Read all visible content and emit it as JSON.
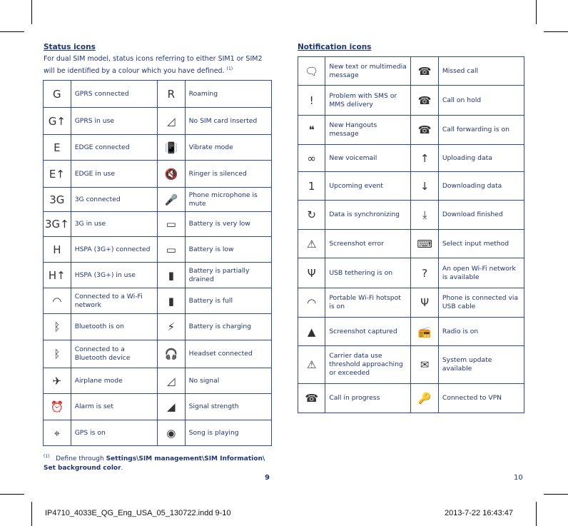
{
  "left": {
    "title": "Status icons",
    "intro": "For dual SIM model, status icons referring to either SIM1 or SIM2 will be identified by a colour which you have defined.",
    "intro_note": "(1)",
    "rows": [
      [
        "G",
        "GPRS connected",
        "R",
        "Roaming"
      ],
      [
        "G↑",
        "GPRS in use",
        "◿",
        "No SIM card inserted"
      ],
      [
        "E",
        "EDGE connected",
        "📳",
        "Vibrate mode"
      ],
      [
        "E↑",
        "EDGE in use",
        "🔇",
        "Ringer is silenced"
      ],
      [
        "3G",
        "3G connected",
        "🎤",
        "Phone microphone is mute"
      ],
      [
        "3G↑",
        "3G in use",
        "▭",
        "Battery is very low"
      ],
      [
        "H",
        "HSPA (3G+) connected",
        "▭",
        "Battery is low"
      ],
      [
        "H↑",
        "HSPA (3G+) in use",
        "▮",
        "Battery is partially drained"
      ],
      [
        "◠",
        "Connected to a Wi-Fi network",
        "▮",
        "Battery is full"
      ],
      [
        "ᛒ",
        "Bluetooth is on",
        "⚡",
        "Battery is charging"
      ],
      [
        "ᛒ",
        "Connected to a Bluetooth device",
        "🎧",
        "Headset connected"
      ],
      [
        "✈",
        "Airplane mode",
        "◿",
        "No signal"
      ],
      [
        "⏰",
        "Alarm is set",
        "◢",
        "Signal strength"
      ],
      [
        "⌖",
        "GPS is on",
        "◉",
        "Song is playing"
      ]
    ],
    "footnote_mark": "(1)",
    "footnote_text": "Define through ",
    "footnote_bold": "Settings\\SIM management\\SIM Information\\ Set background color",
    "footnote_end": ".",
    "page": "9"
  },
  "right": {
    "title": "Notification icons",
    "rows": [
      [
        "🗨",
        "New text or multimedia message",
        "☎",
        "Missed call"
      ],
      [
        "!",
        "Problem with SMS or MMS delivery",
        "☎",
        "Call on hold"
      ],
      [
        "❝",
        "New Hangouts message",
        "☎",
        "Call forwarding is on"
      ],
      [
        "∞",
        "New voicemail",
        "↑",
        "Uploading data"
      ],
      [
        "1",
        "Upcoming event",
        "↓",
        "Downloading data"
      ],
      [
        "↻",
        "Data is synchronizing",
        "⤓",
        "Download finished"
      ],
      [
        "⚠",
        "Screenshot error",
        "⌨",
        "Select input method"
      ],
      [
        "Ψ",
        "USB tethering is on",
        "?",
        "An open Wi-Fi network is available"
      ],
      [
        "◠",
        "Portable Wi-Fi hotspot is on",
        "Ψ",
        "Phone is connected via USB cable"
      ],
      [
        "▲",
        "Screenshot captured",
        "📻",
        "Radio is on"
      ],
      [
        "⚠",
        "Carrier data use threshold approaching or exceeded",
        "✉",
        "System update available"
      ],
      [
        "☎",
        "Call in progress",
        "🔑",
        "Connected to VPN"
      ]
    ],
    "page": "10"
  },
  "slug": {
    "file": "IP4710_4033E_QG_Eng_USA_05_130722.indd   9-10",
    "date": "2013-7-22   16:43:47"
  }
}
